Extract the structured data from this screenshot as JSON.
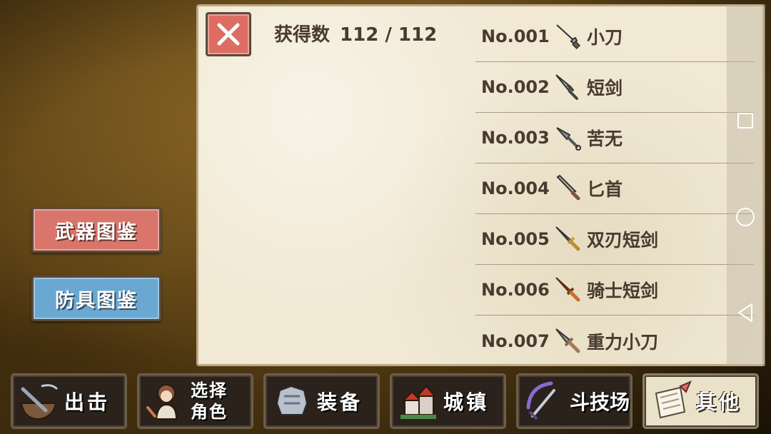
{
  "categories": {
    "weapon_label": "武器图鉴",
    "armor_label": "防具图鉴"
  },
  "panel": {
    "count_label": "获得数",
    "count_value": "112 / 112"
  },
  "items": [
    {
      "no": "No.001",
      "name": "小刀",
      "icon": "knife-icon",
      "color": "#8a8a96"
    },
    {
      "no": "No.002",
      "name": "短剑",
      "icon": "short-sword-icon",
      "color": "#7a7a86"
    },
    {
      "no": "No.003",
      "name": "苦无",
      "icon": "kunai-icon",
      "color": "#6e6e78"
    },
    {
      "no": "No.004",
      "name": "匕首",
      "icon": "dagger-icon",
      "color": "#8a7a5c"
    },
    {
      "no": "No.005",
      "name": "双刃短剑",
      "icon": "double-edged-sword-icon",
      "color": "#9a8a5a"
    },
    {
      "no": "No.006",
      "name": "骑士短剑",
      "icon": "knight-sword-icon",
      "color": "#e07a2a"
    },
    {
      "no": "No.007",
      "name": "重力小刀",
      "icon": "gravity-knife-icon",
      "color": "#8a7a70"
    }
  ],
  "tabs": [
    {
      "label": "出击",
      "icon": "sortie-icon"
    },
    {
      "label1": "选择",
      "label2": "角色",
      "icon": "character-icon"
    },
    {
      "label": "装备",
      "icon": "armor-icon"
    },
    {
      "label": "城镇",
      "icon": "town-icon"
    },
    {
      "label": "斗技场",
      "icon": "arena-icon"
    },
    {
      "label": "其他",
      "icon": "scroll-icon"
    }
  ],
  "colors": {
    "weapon_button": "#d9756a",
    "armor_button": "#6aa8d2",
    "close_button": "#dd6d62",
    "parchment": "#f1e9d4",
    "text": "#4a3a30"
  }
}
